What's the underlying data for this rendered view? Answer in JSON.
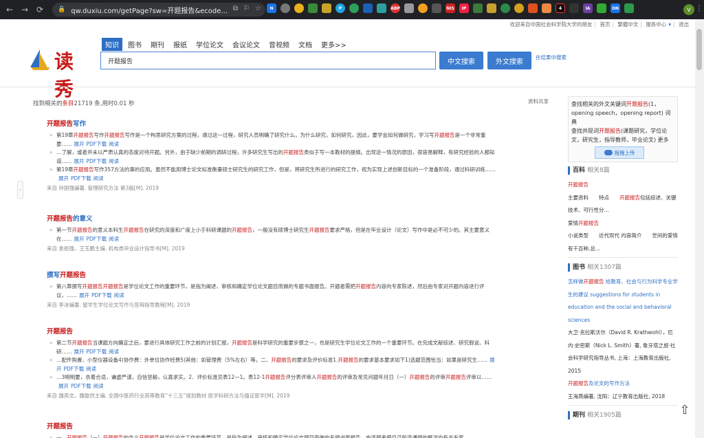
{
  "browser": {
    "url": "qw.duxiu.com/getPage?sw=开题报告&ecode...",
    "avatar_letter": "V"
  },
  "toplinks": {
    "welcome": "欢迎来自中国社会科学院大学的朋友",
    "home": "首页",
    "traditional": "繁體中文",
    "service": "服务中心",
    "logout": "退出"
  },
  "logo": {
    "text": "读秀"
  },
  "tabs": [
    "知识",
    "图书",
    "期刊",
    "报纸",
    "学位论文",
    "会议论文",
    "音视频",
    "文档",
    "更多>>"
  ],
  "search": {
    "value": "开题报告",
    "btn_zh": "中文搜索",
    "btn_wai": "外文搜索",
    "in_result": "在结果中搜索"
  },
  "summary": {
    "prefix": "找到相关的",
    "keyword": "条目",
    "rest": "21719 条,用时0.01 秒",
    "share": "资料共享"
  },
  "results": [
    {
      "title_hl": "开题报告",
      "title_rest": "写作",
      "lines": [
        {
          "segs": [
            [
              "",
              "第19章"
            ],
            [
              "hl",
              "开题报告"
            ],
            [
              "",
              "写作"
            ],
            [
              "hl",
              "开题报告"
            ],
            [
              "",
              "写作是一个构思研究方案的过程，通过这一过程，研究人员明确了研究什么，为什么研究，如何研究，因此，要学会如何做研究，学习写"
            ],
            [
              "hl",
              "开题报告"
            ],
            [
              "",
              "是一个非常重要……"
            ]
          ],
          "links": [
            "展开",
            "PDF下载",
            "阅读"
          ]
        },
        {
          "segs": [
            [
              "",
              "…了解，或者并未以严肃认真的态度对待开题。另外，由于缺少前期的调研过程，许多研究生写出的"
            ],
            [
              "hl",
              "开题报告"
            ],
            [
              "",
              "类似于写一本教材的提纲。出现这一情况的原因，很容易解释，有研究经验的人都知道……"
            ]
          ],
          "links": [
            "展开",
            "PDF下载",
            "阅读"
          ]
        },
        {
          "segs": [
            [
              "",
              "第19章"
            ],
            [
              "hl",
              "开题报告"
            ],
            [
              "",
              "写作357方法的事的应用。虽然不能用博士论文标准衡量硕士研究生的研究工作，但是，将研究生所进行的研究工作，视为实现上述创新目标的一个准备阶段，通过科研训练……"
            ]
          ],
          "links": [
            "展开",
            "PDF下载",
            "阅读"
          ]
        }
      ],
      "src": "来自 孙国强编著. 管理研究方法 第3版[M]. 2019"
    },
    {
      "title_hl": "开题报告",
      "title_rest": "的意义",
      "lines": [
        {
          "segs": [
            [
              "",
              "第一节"
            ],
            [
              "hl",
              "开题报告"
            ],
            [
              "",
              "的意义本科生"
            ],
            [
              "hl",
              "开题报告"
            ],
            [
              "",
              "在研究的深度和广度上小于科研课题的"
            ],
            [
              "hl",
              "开题报告"
            ],
            [
              "",
              "，一般没有硕博士研究生"
            ],
            [
              "hl",
              "开题报告"
            ],
            [
              "",
              "要求严格，但是在毕业设计（论文）写作中是必不可少的。其主要意义在……"
            ]
          ],
          "links": [
            "展开",
            "PDF下载",
            "阅读"
          ]
        }
      ],
      "src": "来自 袁祖强，王玉鹏主编. 机电类毕业设计指导书[M]. 2019"
    },
    {
      "title_pre": "撰写",
      "title_hl": "开题报告",
      "title_rest": "",
      "lines": [
        {
          "segs": [
            [
              "",
              "第八章撰写"
            ],
            [
              "hl",
              "开题报告"
            ],
            [
              "hl",
              "开题报告"
            ],
            [
              "",
              "是学位论文工作的重要环节，是指为阐述、审核和确定学位论文题目而做的专题书面报告。开题者需把"
            ],
            [
              "hl",
              "开题报告"
            ],
            [
              "",
              "内容向专家陈述，然后由专家对开题内容进行评议，……"
            ]
          ],
          "links": [
            "展开",
            "PDF下载",
            "阅读"
          ]
        }
      ],
      "src": "来自 李冰编著. 留学生学位论文写作与答辩指导教程[M]. 2019"
    },
    {
      "title_hl": "开题报告",
      "title_rest": "",
      "lines": [
        {
          "segs": [
            [
              "",
              "第二节"
            ],
            [
              "hl",
              "开题报告"
            ],
            [
              "",
              "当课题方向确定之后，要进行具体研究工作之前的计划汇报，"
            ],
            [
              "hl",
              "开题报告"
            ],
            [
              "",
              "是科学研究的重要步骤之一，也是研究生学位论文工作的一个重要环节。在完成文献综述、研究假说、科研……"
            ]
          ],
          "links": [
            "展开",
            "PDF下载",
            "阅读"
          ]
        },
        {
          "segs": [
            [
              "",
              "…配件购置、小型仪器设备4)协作费：外单位协作经费5)其他：如管理费（5%左右）等。二、"
            ],
            [
              "hl",
              "开题报告"
            ],
            [
              "",
              "的要求及评价标准1."
            ],
            [
              "hl",
              "开题报告"
            ],
            [
              "",
              "的要求基本要求如下1)选题范围恰当：如果是研究生……"
            ]
          ],
          "links": [
            "展开",
            "PDF下载",
            "阅读"
          ]
        },
        {
          "segs": [
            [
              "",
              "…3明明要，衣着合适，谦虚严谨，自信坚毅，认真求实。2．评价标准见表12—1。表12-1"
            ],
            [
              "hl",
              "开题报告"
            ],
            [
              "",
              "评分表评审人"
            ],
            [
              "hl",
              "开题报告"
            ],
            [
              "",
              "的评审及常见问题年月日（一）"
            ],
            [
              "hl",
              "开题报告"
            ],
            [
              "",
              "的评审"
            ],
            [
              "hl",
              "开题报告"
            ],
            [
              "",
              "评审以……"
            ]
          ],
          "links": [
            "展开",
            "PDF下载",
            "阅读"
          ]
        }
      ],
      "src": "来自 魏高文，魏歆然主编. 全国中医药行业高等教育“十三五”规划教材 医学科研方法与循证医学[M]. 2019"
    },
    {
      "title_hl": "开题报告",
      "title_rest": "",
      "lines": [
        {
          "segs": [
            [
              "",
              "一、"
            ],
            [
              "hl",
              "开题报告"
            ],
            [
              "",
              "（一）"
            ],
            [
              "hl",
              "开题报告"
            ],
            [
              "",
              "的含义"
            ],
            [
              "hl",
              "开题报告"
            ],
            [
              "",
              "是学位论文工作的重要环节，是指为阐述、审核和确定学位论文题目而做的专题书面报告，由选题者把自己所选课题的概况向有关专家……"
            ]
          ],
          "links": []
        }
      ],
      "src": ""
    }
  ],
  "panel": {
    "box": {
      "l1a": "查找相关的外文关键词",
      "l1hl": "开题报告",
      "l1b": "(1，opening speech，opening report) 词典",
      "l2a": "查找共现词",
      "l2hl": "开题报告",
      "l2b": "(课题研究，学位论文，研究生，指导教师，毕业论文) 更多",
      "upload": "拖拽上传"
    },
    "baike": {
      "title": "百科",
      "count": "相关8篇",
      "items": [
        [
          [
            "hl",
            "开题报告"
          ]
        ],
        [
          [
            "",
            "主要资料　　特点　　"
          ],
          [
            "hl",
            "开题报告"
          ],
          [
            "",
            "包括综述、关键技术、可行性分..."
          ]
        ],
        [
          [
            "",
            "爱情"
          ],
          [
            "hl",
            "开题报告"
          ]
        ],
        [
          [
            "",
            "小说类型　　近代现代 内容简介　　世间的爱情有千百种,总..."
          ]
        ]
      ]
    },
    "books": {
      "title": "图书",
      "count": "相关1307篇",
      "items": [
        [
          [
            "blue",
            "怎样做"
          ],
          [
            "hl",
            "开题报告"
          ],
          [
            "blue",
            " 给教育、社会与行为科学专业学生的建议 suggestions for students in education and the social and behavioral sciences"
          ]
        ],
        [
          [
            "",
            "大卫·克拉斯沃尔（David R. Krathwohl），厄内·史密斯（Nick L. Smith）著, 象牙塔之旅·社会科学研究指导丛书, 上海：上海教育出版社, 2015"
          ]
        ],
        [
          [
            "hl",
            "开题报告"
          ],
          [
            "blue",
            "及论文的写作方法"
          ]
        ],
        [
          [
            "",
            "王海燕编著, 沈阳：辽宁教育出版社, 2018"
          ]
        ]
      ]
    },
    "journal": {
      "title": "期刊",
      "count": "相关1905篇"
    }
  }
}
